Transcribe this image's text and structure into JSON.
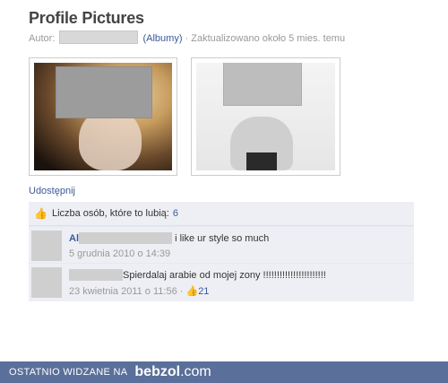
{
  "album": {
    "title": "Profile Pictures",
    "author_prefix": "Autor:",
    "albums_link": "(Albumy)",
    "updated": "· Zaktualizowano około 5 mies. temu"
  },
  "share_label": "Udostępnij",
  "likes": {
    "label": "Liczba osób, które to lubią:",
    "count": "6",
    "icon": "like-thumb-icon"
  },
  "comments": [
    {
      "name": "Al",
      "text": "i like ur style so much",
      "date": "5 grudnia 2010 o 14:39",
      "likes": ""
    },
    {
      "name": "",
      "text": "Spierdalaj arabie od mojej zony !!!!!!!!!!!!!!!!!!!!!!!",
      "date": "23 kwietnia 2011 o 11:56",
      "likes": "21"
    }
  ],
  "footer": {
    "label": "OSTATNIO WIDZANE NA",
    "brand_bold": "bebzol",
    "brand_rest": ".com"
  },
  "colors": {
    "link": "#3b5998",
    "comment_bg": "#edeff4",
    "footer_bg": "#5a6f99"
  }
}
